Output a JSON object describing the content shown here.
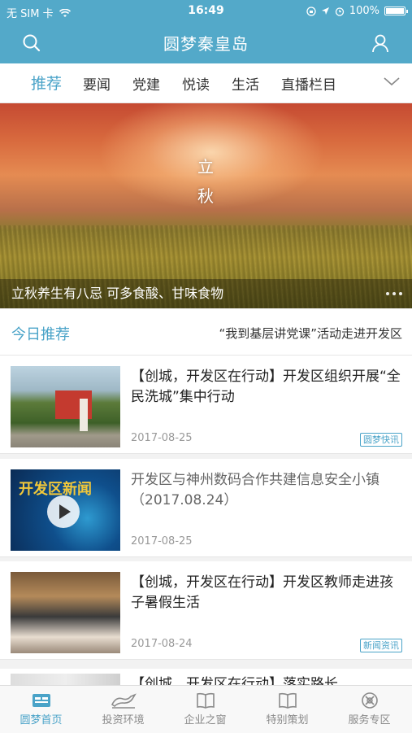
{
  "status": {
    "carrier": "无 SIM 卡",
    "time": "16:49",
    "battery": "100%"
  },
  "header": {
    "title": "圆梦秦皇岛"
  },
  "tabs": [
    {
      "label": "推荐",
      "active": true
    },
    {
      "label": "要闻"
    },
    {
      "label": "党建"
    },
    {
      "label": "悦读"
    },
    {
      "label": "生活"
    },
    {
      "label": "直播栏目"
    }
  ],
  "banner": {
    "overlay_text": "立秋",
    "char1": "立",
    "char2": "秋",
    "caption": "立秋养生有八忌 可多食酸、甘味食物"
  },
  "today": {
    "label": "今日推荐",
    "headline": "“我到基层讲党课”活动走进开发区"
  },
  "news": [
    {
      "title": "【创城，开发区在行动】开发区组织开展“全民洗城”集中行动",
      "date": "2017-08-25",
      "tag": "圆梦快讯"
    },
    {
      "title": "开发区与神州数码合作共建信息安全小镇（2017.08.24）",
      "date": "2017-08-25",
      "tag": ""
    },
    {
      "title": "【创城，开发区在行动】开发区教师走进孩子暑假生活",
      "date": "2017-08-24",
      "tag": "新闻资讯"
    }
  ],
  "peek": {
    "title": "【创城，开发区在行动】落实路长"
  },
  "thumb2_text": "开发区新闻",
  "bottom_nav": [
    {
      "label": "圆梦首页",
      "active": true
    },
    {
      "label": "投资环境"
    },
    {
      "label": "企业之窗"
    },
    {
      "label": "特别策划"
    },
    {
      "label": "服务专区"
    }
  ],
  "colors": {
    "brand": "#53a9c9",
    "accent": "#4aa3c8"
  }
}
